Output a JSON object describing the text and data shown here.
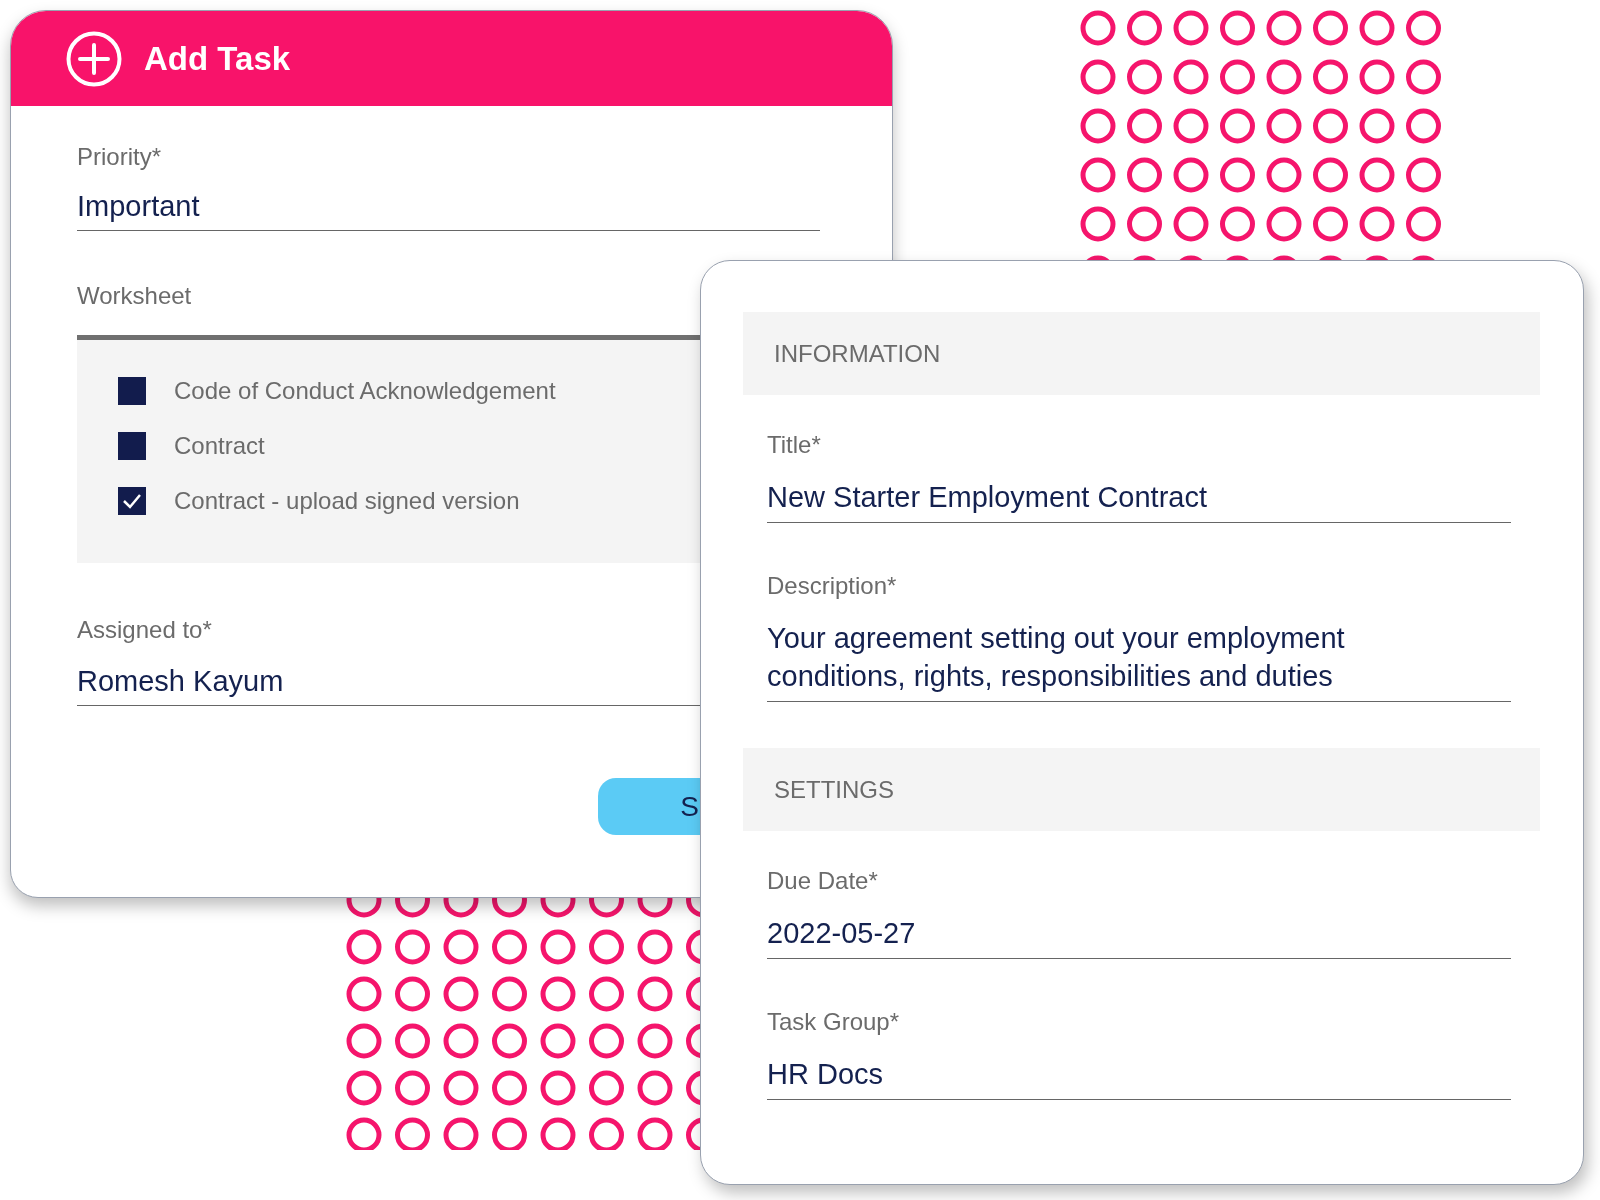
{
  "add_task": {
    "title": "Add Task",
    "priority": {
      "label": "Priority*",
      "value": "Important"
    },
    "worksheet": {
      "label": "Worksheet",
      "items": [
        {
          "label": "Code of Conduct Acknowledgement",
          "checked": false
        },
        {
          "label": "Contract",
          "checked": false
        },
        {
          "label": "Contract - upload signed version",
          "checked": true
        }
      ]
    },
    "assigned_to": {
      "label": "Assigned to*",
      "value": "Romesh Kayum"
    },
    "save_button": {
      "label": "S"
    }
  },
  "task_details": {
    "sections": [
      {
        "heading": "INFORMATION",
        "fields": [
          {
            "label": "Title*",
            "value": "New Starter Employment Contract"
          },
          {
            "label": "Description*",
            "value": "Your agreement setting out your employment conditions, rights, responsibilities and duties"
          }
        ]
      },
      {
        "heading": "SETTINGS",
        "fields": [
          {
            "label": "Due Date*",
            "value": "2022-05-27"
          },
          {
            "label": "Task Group*",
            "value": "HR Docs"
          }
        ]
      }
    ]
  }
}
